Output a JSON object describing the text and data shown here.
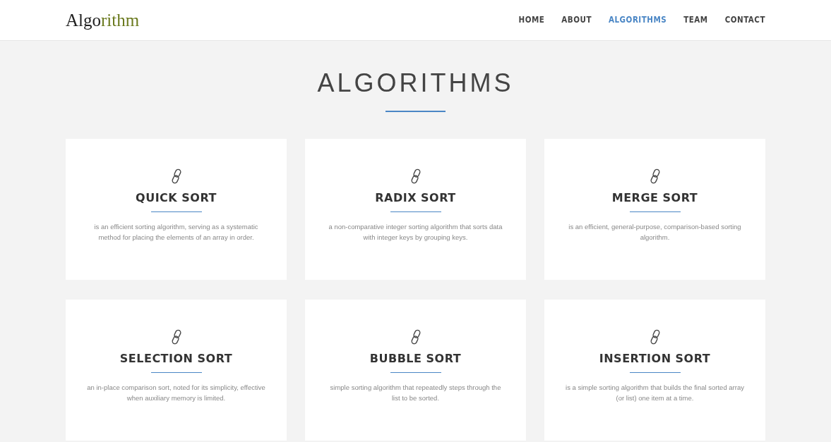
{
  "logo": [
    {
      "text": "Algo",
      "color": "#1f1f1f"
    },
    {
      "text": "rithm",
      "color": "#6b7a1f"
    }
  ],
  "nav": [
    {
      "label": "HOME",
      "selected": false
    },
    {
      "label": "ABOUT",
      "selected": false
    },
    {
      "label": "ALGORITHMS",
      "selected": true
    },
    {
      "label": "TEAM",
      "selected": false
    },
    {
      "label": "CONTACT",
      "selected": false
    }
  ],
  "section": {
    "title": "ALGORITHMS"
  },
  "cards": [
    {
      "title": "QUICK SORT",
      "text": "is an efficient sorting algorithm, serving as a systematic method for placing the elements of an array in order."
    },
    {
      "title": "RADIX SORT",
      "text": "a non-comparative integer sorting algorithm that sorts data with integer keys by grouping keys."
    },
    {
      "title": "MERGE SORT",
      "text": "is an efficient, general-purpose, comparison-based sorting algorithm."
    },
    {
      "title": "SELECTION SORT",
      "text": "an in-place comparison sort, noted for its simplicity, effective when auxiliary memory is limited."
    },
    {
      "title": "BUBBLE SORT",
      "text": "simple sorting algorithm that repeatedly steps through the list to be sorted."
    },
    {
      "title": "INSERTION SORT",
      "text": "is a simple sorting algorithm that builds the final sorted array (or list) one item at a time."
    }
  ]
}
